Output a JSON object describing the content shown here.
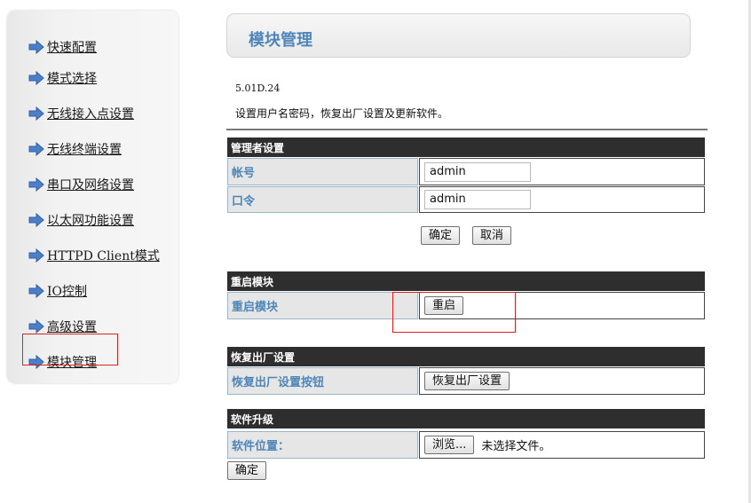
{
  "sidebar": {
    "items": [
      {
        "label": "快速配置",
        "icon": "arrow-right-icon"
      },
      {
        "label": "模式选择",
        "icon": "arrow-right-icon"
      },
      {
        "label": "无线接入点设置",
        "icon": "arrow-right-icon"
      },
      {
        "label": "无线终端设置",
        "icon": "arrow-right-icon"
      },
      {
        "label": "串口及网络设置",
        "icon": "arrow-right-icon"
      },
      {
        "label": "以太网功能设置",
        "icon": "arrow-right-icon"
      },
      {
        "label": "HTTPD Client模式",
        "icon": "arrow-right-icon"
      },
      {
        "label": "IO控制",
        "icon": "arrow-right-icon"
      },
      {
        "label": "高级设置",
        "icon": "arrow-right-icon"
      },
      {
        "label": "模块管理",
        "icon": "arrow-right-icon"
      }
    ],
    "active": "模块管理"
  },
  "header": {
    "title": "模块管理"
  },
  "version": "5.01D.24",
  "description": "设置用户名密码，恢复出厂设置及更新软件。",
  "admin": {
    "section_title": "管理者设置",
    "username_label": "帐号",
    "username_value": "admin",
    "password_label": "口令",
    "password_value": "admin",
    "confirm_label": "确定",
    "cancel_label": "取消"
  },
  "restart": {
    "section_title": "重启模块",
    "row_label": "重启模块",
    "button_label": "重启"
  },
  "factory": {
    "section_title": "恢复出厂设置",
    "row_label": "恢复出厂设置按钮",
    "button_label": "恢复出厂设置"
  },
  "upgrade": {
    "section_title": "软件升级",
    "row_label": "软件位置：",
    "browse_label": "浏览...",
    "file_status": "未选择文件。",
    "confirm_label": "确定"
  },
  "colors": {
    "accent": "#4f86b9",
    "section_bg": "#2e2e2e",
    "highlight": "#dd2222"
  }
}
